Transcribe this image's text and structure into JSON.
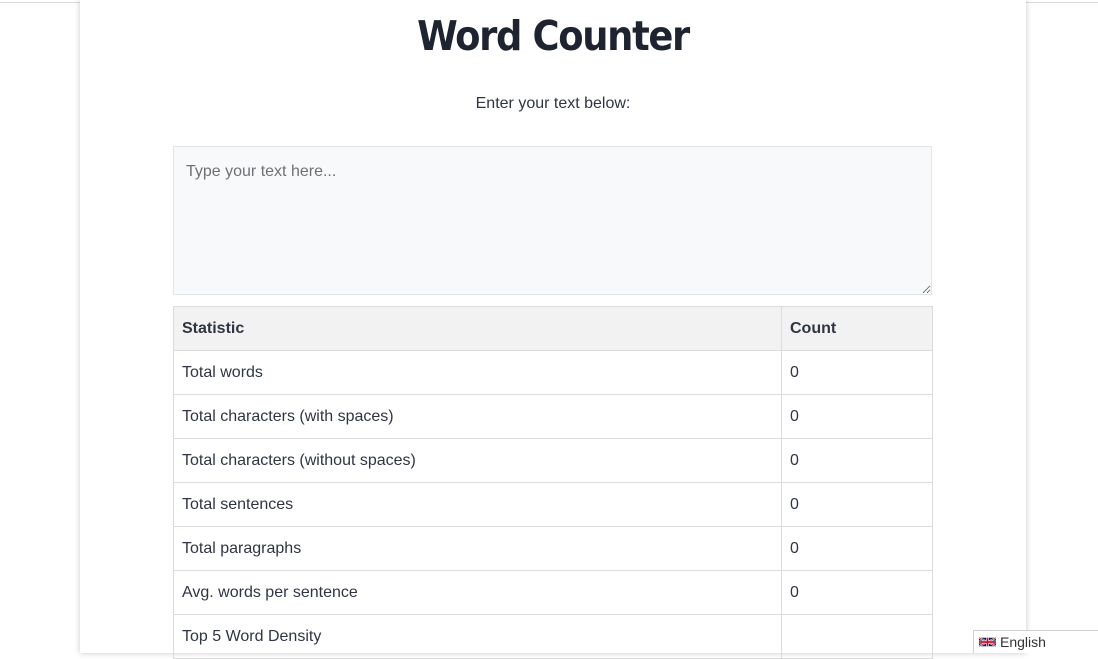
{
  "header": {
    "title": "Word Counter",
    "subtitle": "Enter your text below:"
  },
  "input": {
    "placeholder": "Type your text here...",
    "value": ""
  },
  "table": {
    "headers": {
      "statistic": "Statistic",
      "count": "Count"
    },
    "rows": [
      {
        "label": "Total words",
        "value": "0"
      },
      {
        "label": "Total characters (with spaces)",
        "value": "0"
      },
      {
        "label": "Total characters (without spaces)",
        "value": "0"
      },
      {
        "label": "Total sentences",
        "value": "0"
      },
      {
        "label": "Total paragraphs",
        "value": "0"
      },
      {
        "label": "Avg. words per sentence",
        "value": "0"
      },
      {
        "label": "Top 5 Word Density",
        "value": ""
      }
    ]
  },
  "language": {
    "label": "English",
    "flag_icon": "uk-flag-icon"
  },
  "colors": {
    "title": "#1d2430",
    "text": "#2f3542",
    "header_bg": "#f2f2f2",
    "input_bg": "#f8f9fa",
    "border": "#dcdcdc"
  }
}
